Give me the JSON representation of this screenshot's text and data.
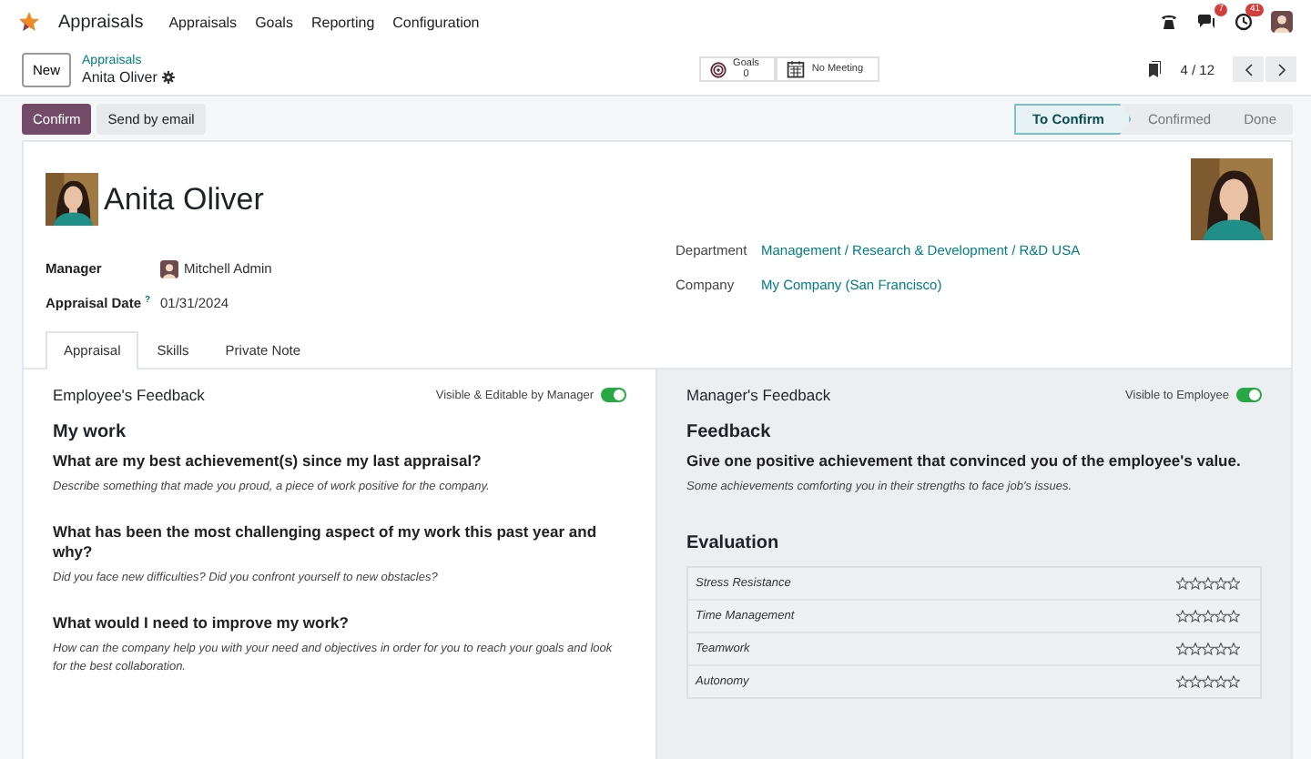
{
  "navbar": {
    "app_name": "Appraisals",
    "menu": [
      "Appraisals",
      "Goals",
      "Reporting",
      "Configuration"
    ],
    "badges": [
      {
        "kind": "messages",
        "count": "7"
      },
      {
        "kind": "activities",
        "count": "41"
      }
    ]
  },
  "control_panel": {
    "new_button": "New",
    "breadcrumb": "Appraisals",
    "record": "Anita Oliver",
    "smart_buttons": [
      {
        "kind": "goals",
        "label": "Goals",
        "value": "0"
      },
      {
        "kind": "meeting",
        "label": "No Meeting"
      }
    ],
    "pager": "4 / 12"
  },
  "actions": [
    {
      "label": "Confirm",
      "kind": "primary"
    },
    {
      "label": "Send by email",
      "kind": "secondary"
    }
  ],
  "stages": [
    {
      "label": "To Confirm",
      "selected": true
    },
    {
      "label": "Confirmed",
      "selected": false
    },
    {
      "label": "Done",
      "selected": false
    }
  ],
  "employee": {
    "name": "Anita Oliver"
  },
  "fields_left": [
    {
      "label": "Manager",
      "value": "Mitchell Admin",
      "kind": "user"
    },
    {
      "label": "Appraisal Date",
      "help": "?",
      "value": "01/31/2024",
      "kind": "text"
    }
  ],
  "fields_right": [
    {
      "label": "Department",
      "value": "Management / Research & Development / R&D USA",
      "kind": "link"
    },
    {
      "label": "Company",
      "value": "My Company (San Francisco)",
      "kind": "link"
    }
  ],
  "tabs": [
    {
      "label": "Appraisal",
      "selected": true
    },
    {
      "label": "Skills",
      "selected": false
    },
    {
      "label": "Private Note",
      "selected": false
    }
  ],
  "employee_feedback": {
    "title": "Employee's Feedback",
    "toggle_label": "Visible & Editable by Manager",
    "on": true,
    "heading": "My work",
    "questions": [
      {
        "question": "What are my best achievement(s) since my last appraisal?",
        "hint": "Describe something that made you proud, a piece of work positive for the company."
      },
      {
        "question": "What has been the most challenging aspect of my work this past year and why?",
        "hint": "Did you face new difficulties? Did you confront yourself to new obstacles?"
      },
      {
        "question": "What would I need to improve my work?",
        "hint": "How can the company help you with your need and objectives in order for you to reach your goals and look for the best collaboration."
      }
    ]
  },
  "manager_feedback": {
    "title": "Manager's Feedback",
    "toggle_label": "Visible to Employee",
    "on": true,
    "heading": "Feedback",
    "questions": [
      {
        "question": "Give one positive achievement that convinced you of the employee's value.",
        "hint": "Some achievements comforting you in their strengths to face job's issues."
      }
    ],
    "evaluation": {
      "title": "Evaluation",
      "rows": [
        {
          "label": "Stress Resistance",
          "stars": 0
        },
        {
          "label": "Time Management",
          "stars": 0
        },
        {
          "label": "Teamwork",
          "stars": 0
        },
        {
          "label": "Autonomy",
          "stars": 0
        }
      ]
    }
  }
}
